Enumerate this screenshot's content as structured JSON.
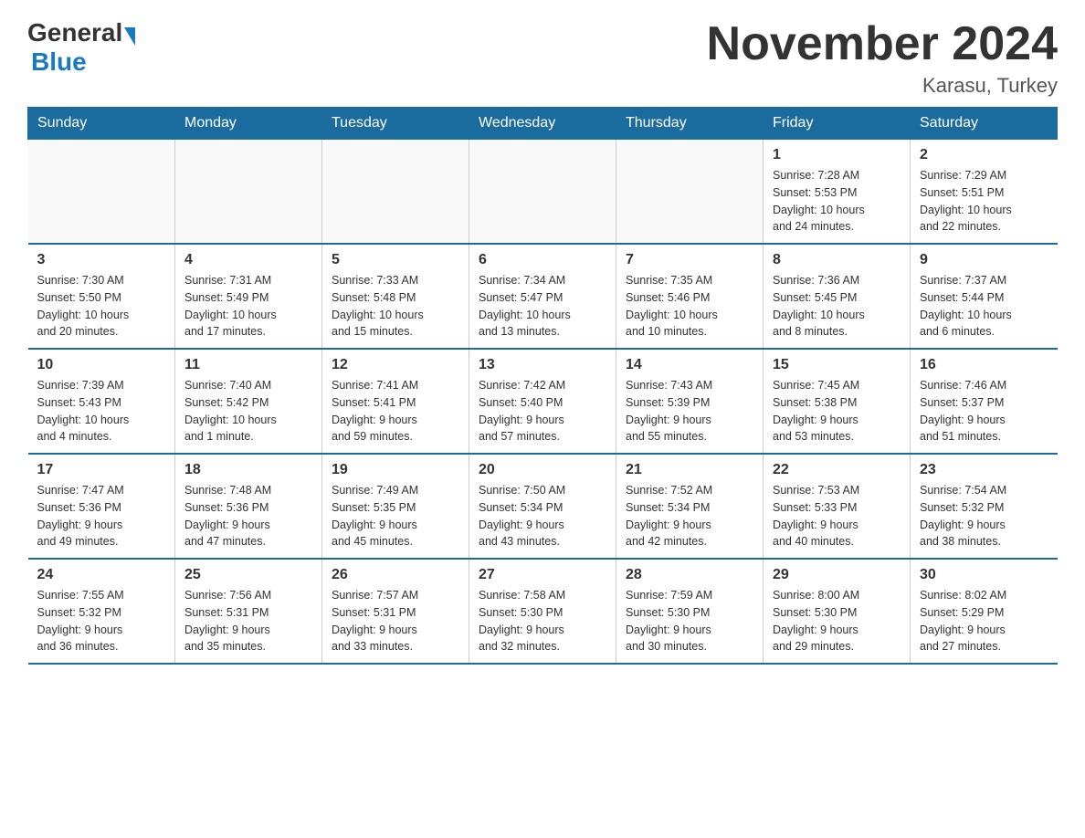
{
  "header": {
    "logo_general": "General",
    "logo_blue": "Blue",
    "month_title": "November 2024",
    "location": "Karasu, Turkey"
  },
  "weekdays": [
    "Sunday",
    "Monday",
    "Tuesday",
    "Wednesday",
    "Thursday",
    "Friday",
    "Saturday"
  ],
  "weeks": [
    [
      {
        "day": "",
        "info": ""
      },
      {
        "day": "",
        "info": ""
      },
      {
        "day": "",
        "info": ""
      },
      {
        "day": "",
        "info": ""
      },
      {
        "day": "",
        "info": ""
      },
      {
        "day": "1",
        "info": "Sunrise: 7:28 AM\nSunset: 5:53 PM\nDaylight: 10 hours\nand 24 minutes."
      },
      {
        "day": "2",
        "info": "Sunrise: 7:29 AM\nSunset: 5:51 PM\nDaylight: 10 hours\nand 22 minutes."
      }
    ],
    [
      {
        "day": "3",
        "info": "Sunrise: 7:30 AM\nSunset: 5:50 PM\nDaylight: 10 hours\nand 20 minutes."
      },
      {
        "day": "4",
        "info": "Sunrise: 7:31 AM\nSunset: 5:49 PM\nDaylight: 10 hours\nand 17 minutes."
      },
      {
        "day": "5",
        "info": "Sunrise: 7:33 AM\nSunset: 5:48 PM\nDaylight: 10 hours\nand 15 minutes."
      },
      {
        "day": "6",
        "info": "Sunrise: 7:34 AM\nSunset: 5:47 PM\nDaylight: 10 hours\nand 13 minutes."
      },
      {
        "day": "7",
        "info": "Sunrise: 7:35 AM\nSunset: 5:46 PM\nDaylight: 10 hours\nand 10 minutes."
      },
      {
        "day": "8",
        "info": "Sunrise: 7:36 AM\nSunset: 5:45 PM\nDaylight: 10 hours\nand 8 minutes."
      },
      {
        "day": "9",
        "info": "Sunrise: 7:37 AM\nSunset: 5:44 PM\nDaylight: 10 hours\nand 6 minutes."
      }
    ],
    [
      {
        "day": "10",
        "info": "Sunrise: 7:39 AM\nSunset: 5:43 PM\nDaylight: 10 hours\nand 4 minutes."
      },
      {
        "day": "11",
        "info": "Sunrise: 7:40 AM\nSunset: 5:42 PM\nDaylight: 10 hours\nand 1 minute."
      },
      {
        "day": "12",
        "info": "Sunrise: 7:41 AM\nSunset: 5:41 PM\nDaylight: 9 hours\nand 59 minutes."
      },
      {
        "day": "13",
        "info": "Sunrise: 7:42 AM\nSunset: 5:40 PM\nDaylight: 9 hours\nand 57 minutes."
      },
      {
        "day": "14",
        "info": "Sunrise: 7:43 AM\nSunset: 5:39 PM\nDaylight: 9 hours\nand 55 minutes."
      },
      {
        "day": "15",
        "info": "Sunrise: 7:45 AM\nSunset: 5:38 PM\nDaylight: 9 hours\nand 53 minutes."
      },
      {
        "day": "16",
        "info": "Sunrise: 7:46 AM\nSunset: 5:37 PM\nDaylight: 9 hours\nand 51 minutes."
      }
    ],
    [
      {
        "day": "17",
        "info": "Sunrise: 7:47 AM\nSunset: 5:36 PM\nDaylight: 9 hours\nand 49 minutes."
      },
      {
        "day": "18",
        "info": "Sunrise: 7:48 AM\nSunset: 5:36 PM\nDaylight: 9 hours\nand 47 minutes."
      },
      {
        "day": "19",
        "info": "Sunrise: 7:49 AM\nSunset: 5:35 PM\nDaylight: 9 hours\nand 45 minutes."
      },
      {
        "day": "20",
        "info": "Sunrise: 7:50 AM\nSunset: 5:34 PM\nDaylight: 9 hours\nand 43 minutes."
      },
      {
        "day": "21",
        "info": "Sunrise: 7:52 AM\nSunset: 5:34 PM\nDaylight: 9 hours\nand 42 minutes."
      },
      {
        "day": "22",
        "info": "Sunrise: 7:53 AM\nSunset: 5:33 PM\nDaylight: 9 hours\nand 40 minutes."
      },
      {
        "day": "23",
        "info": "Sunrise: 7:54 AM\nSunset: 5:32 PM\nDaylight: 9 hours\nand 38 minutes."
      }
    ],
    [
      {
        "day": "24",
        "info": "Sunrise: 7:55 AM\nSunset: 5:32 PM\nDaylight: 9 hours\nand 36 minutes."
      },
      {
        "day": "25",
        "info": "Sunrise: 7:56 AM\nSunset: 5:31 PM\nDaylight: 9 hours\nand 35 minutes."
      },
      {
        "day": "26",
        "info": "Sunrise: 7:57 AM\nSunset: 5:31 PM\nDaylight: 9 hours\nand 33 minutes."
      },
      {
        "day": "27",
        "info": "Sunrise: 7:58 AM\nSunset: 5:30 PM\nDaylight: 9 hours\nand 32 minutes."
      },
      {
        "day": "28",
        "info": "Sunrise: 7:59 AM\nSunset: 5:30 PM\nDaylight: 9 hours\nand 30 minutes."
      },
      {
        "day": "29",
        "info": "Sunrise: 8:00 AM\nSunset: 5:30 PM\nDaylight: 9 hours\nand 29 minutes."
      },
      {
        "day": "30",
        "info": "Sunrise: 8:02 AM\nSunset: 5:29 PM\nDaylight: 9 hours\nand 27 minutes."
      }
    ]
  ]
}
